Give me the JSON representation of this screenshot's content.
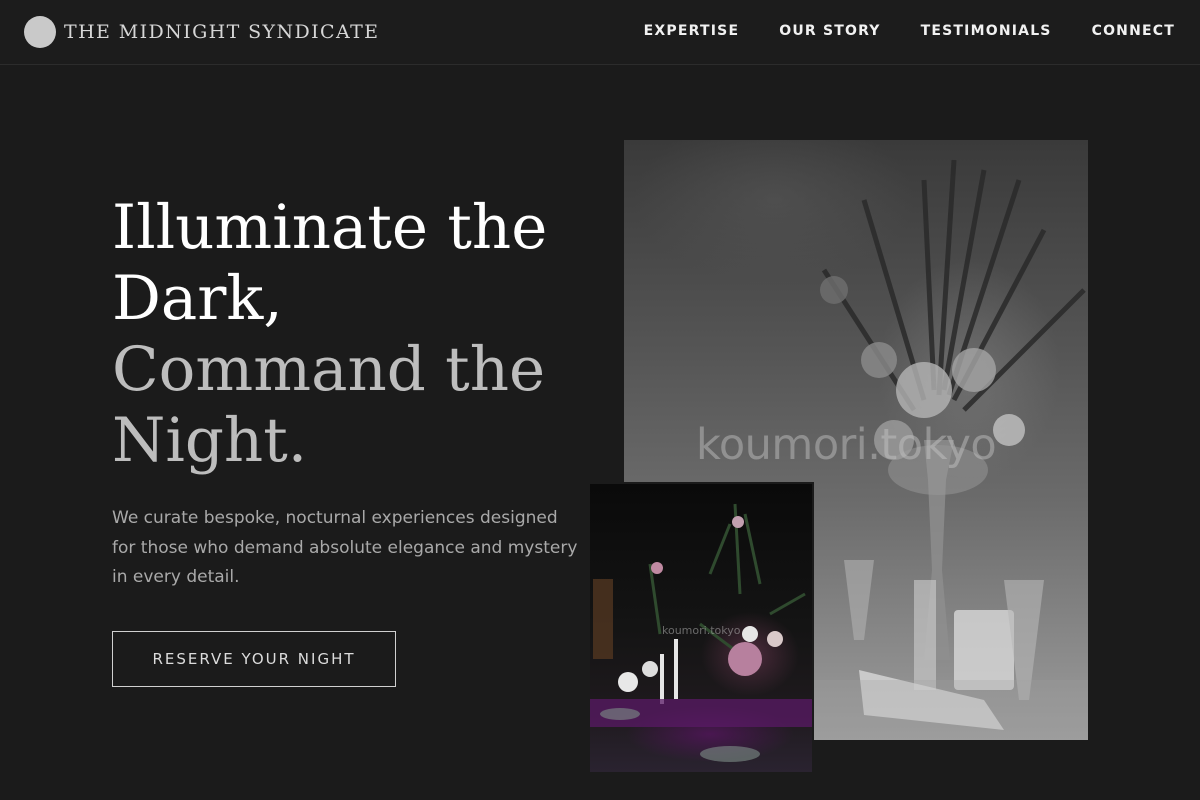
{
  "brand": {
    "name": "THE MIDNIGHT SYNDICATE",
    "logo_icon": "moon-circle-icon"
  },
  "nav": {
    "links": [
      "EXPERTISE",
      "OUR STORY",
      "TESTIMONIALS",
      "CONNECT"
    ]
  },
  "hero": {
    "headline_line1": "Illuminate the",
    "headline_line2": "Dark,",
    "headline_line3": "Command the",
    "headline_line4": "Night.",
    "lede": "We curate bespoke, nocturnal experiences designed for those who demand absolute elegance and mystery in every detail.",
    "cta_label": "RESERVE YOUR NIGHT"
  },
  "images": {
    "main_watermark": "koumori.tokyo",
    "inset_watermark": "koumori.tokyo"
  },
  "colors": {
    "background": "#1b1b1b",
    "text": "#ffffff",
    "muted": "#a9a9a9"
  }
}
